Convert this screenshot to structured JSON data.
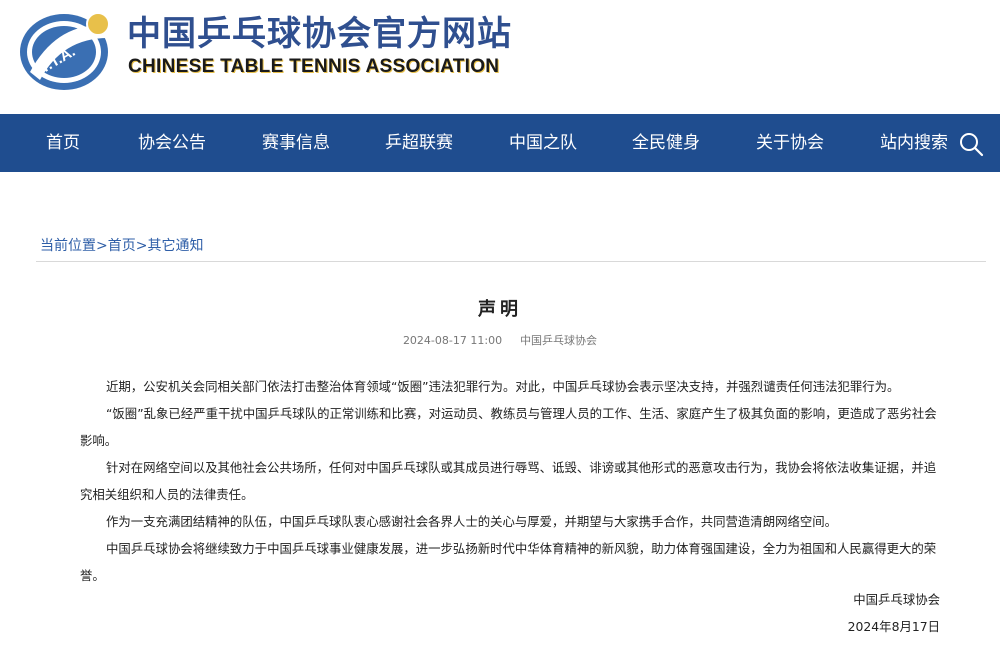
{
  "header": {
    "logo_text": "T.T.A.",
    "title_cn": "中国乒乓球协会官方网站",
    "title_en": "CHINESE TABLE TENNIS ASSOCIATION"
  },
  "nav": {
    "items": [
      {
        "label": "首页"
      },
      {
        "label": "协会公告"
      },
      {
        "label": "赛事信息"
      },
      {
        "label": "乒超联赛"
      },
      {
        "label": "中国之队"
      },
      {
        "label": "全民健身"
      },
      {
        "label": "关于协会"
      },
      {
        "label": "站内搜索"
      }
    ],
    "search_icon": "search-icon"
  },
  "breadcrumb": {
    "prefix": "当前位置",
    "home": "首页",
    "current": "其它通知",
    "separator": ">"
  },
  "article": {
    "title": "声明",
    "date": "2024-08-17 11:00",
    "source": "中国乒乓球协会",
    "paragraphs": [
      "近期，公安机关会同相关部门依法打击整治体育领域“饭圈”违法犯罪行为。对此，中国乒乓球协会表示坚决支持，并强烈谴责任何违法犯罪行为。",
      "“饭圈”乱象已经严重干扰中国乒乓球队的正常训练和比赛，对运动员、教练员与管理人员的工作、生活、家庭产生了极其负面的影响，更造成了恶劣社会影响。",
      "针对在网络空间以及其他社会公共场所，任何对中国乒乓球队或其成员进行辱骂、诋毁、诽谤或其他形式的恶意攻击行为，我协会将依法收集证据，并追究相关组织和人员的法律责任。",
      "作为一支充满团结精神的队伍，中国乒乓球队衷心感谢社会各界人士的关心与厚爱，并期望与大家携手合作，共同营造清朗网络空间。",
      "中国乒乓球协会将继续致力于中国乒乓球事业健康发展，进一步弘扬新时代中华体育精神的新风貌，助力体育强国建设，全力为祖国和人民赢得更大的荣誉。"
    ],
    "signature": "中国乒乓球协会",
    "sign_date": "2024年8月17日"
  },
  "colors": {
    "nav_bg": "#1f4d8f",
    "title_blue": "#2f4f8f",
    "link_blue": "#2f5fa8",
    "logo_yellow": "#e8c04a"
  }
}
